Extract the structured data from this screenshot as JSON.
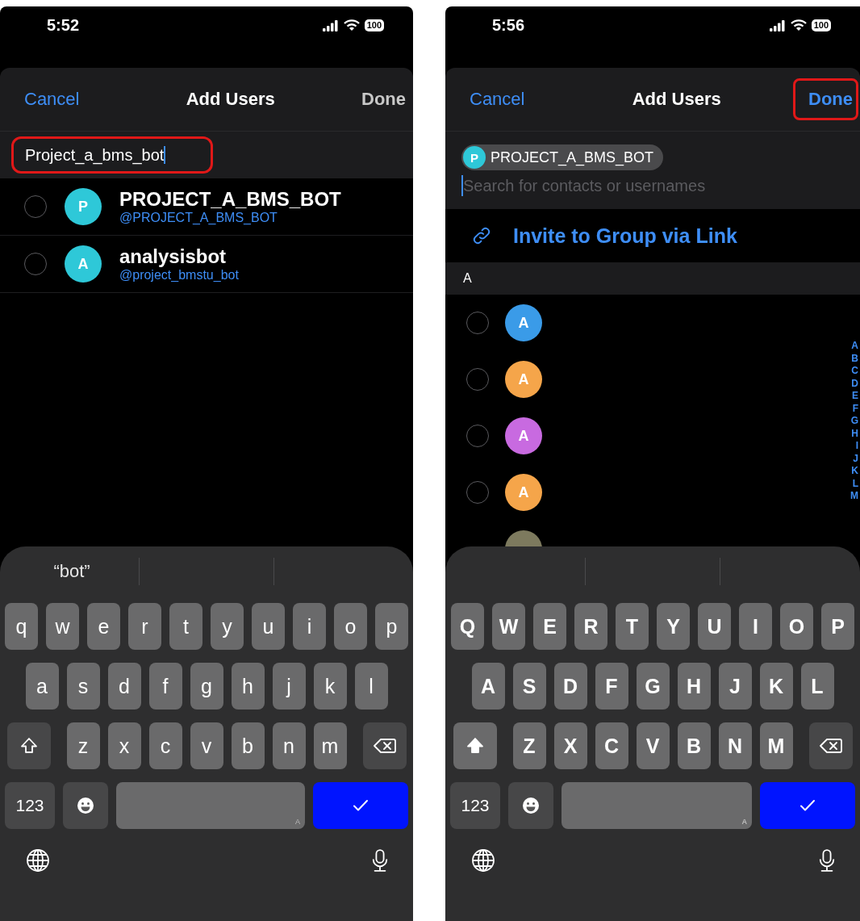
{
  "screens": [
    {
      "status_bar": {
        "time": "5:52",
        "battery": "100"
      },
      "header": {
        "cancel": "Cancel",
        "title": "Add Users",
        "done": "Done",
        "done_enabled": false,
        "done_highlighted": false
      },
      "search": {
        "kind": "typed",
        "value": "Project_a_bms_bot",
        "highlighted": true
      },
      "results": [
        {
          "letter": "P",
          "color": "#2ec8d8",
          "name": "PROJECT_A_BMS_BOT",
          "username": "@PROJECT_A_BMS_BOT",
          "selected": false
        },
        {
          "letter": "A",
          "color": "#2ec8d8",
          "name": "analysisbot",
          "username": "@project_bmstu_bot",
          "selected": false
        }
      ],
      "keyboard": {
        "suggestions": [
          "“bot”"
        ],
        "shift_on": false,
        "rows": [
          [
            "q",
            "w",
            "e",
            "r",
            "t",
            "y",
            "u",
            "i",
            "o",
            "p"
          ],
          [
            "a",
            "s",
            "d",
            "f",
            "g",
            "h",
            "j",
            "k",
            "l"
          ],
          [
            "z",
            "x",
            "c",
            "v",
            "b",
            "n",
            "m"
          ]
        ],
        "numbers_key": "123",
        "space_mark": "A"
      }
    },
    {
      "status_bar": {
        "time": "5:56",
        "battery": "100"
      },
      "header": {
        "cancel": "Cancel",
        "title": "Add Users",
        "done": "Done",
        "done_enabled": true,
        "done_highlighted": true
      },
      "search": {
        "kind": "tokens",
        "tokens": [
          {
            "letter": "P",
            "color": "#2ec8d8",
            "label": "PROJECT_A_BMS_BOT"
          }
        ],
        "placeholder": "Search for contacts or usernames"
      },
      "invite_link": "Invite to Group via Link",
      "section": "A",
      "contacts": [
        {
          "kind": "letter",
          "letter": "A",
          "color": "#3a9be8",
          "selected": false
        },
        {
          "kind": "letter",
          "letter": "A",
          "color": "#f5a54a",
          "selected": false
        },
        {
          "kind": "letter",
          "letter": "A",
          "color": "#c86ae0",
          "selected": false
        },
        {
          "kind": "letter",
          "letter": "A",
          "color": "#f5a54a",
          "selected": false
        },
        {
          "kind": "photo"
        }
      ],
      "index": [
        "A",
        "B",
        "C",
        "D",
        "E",
        "F",
        "G",
        "H",
        "I",
        "J",
        "K",
        "L",
        "M"
      ],
      "keyboard": {
        "shift_on": true,
        "rows": [
          [
            "Q",
            "W",
            "E",
            "R",
            "T",
            "Y",
            "U",
            "I",
            "O",
            "P"
          ],
          [
            "A",
            "S",
            "D",
            "F",
            "G",
            "H",
            "J",
            "K",
            "L"
          ],
          [
            "Z",
            "X",
            "C",
            "V",
            "B",
            "N",
            "M"
          ]
        ],
        "numbers_key": "123",
        "space_mark": "A"
      }
    }
  ]
}
